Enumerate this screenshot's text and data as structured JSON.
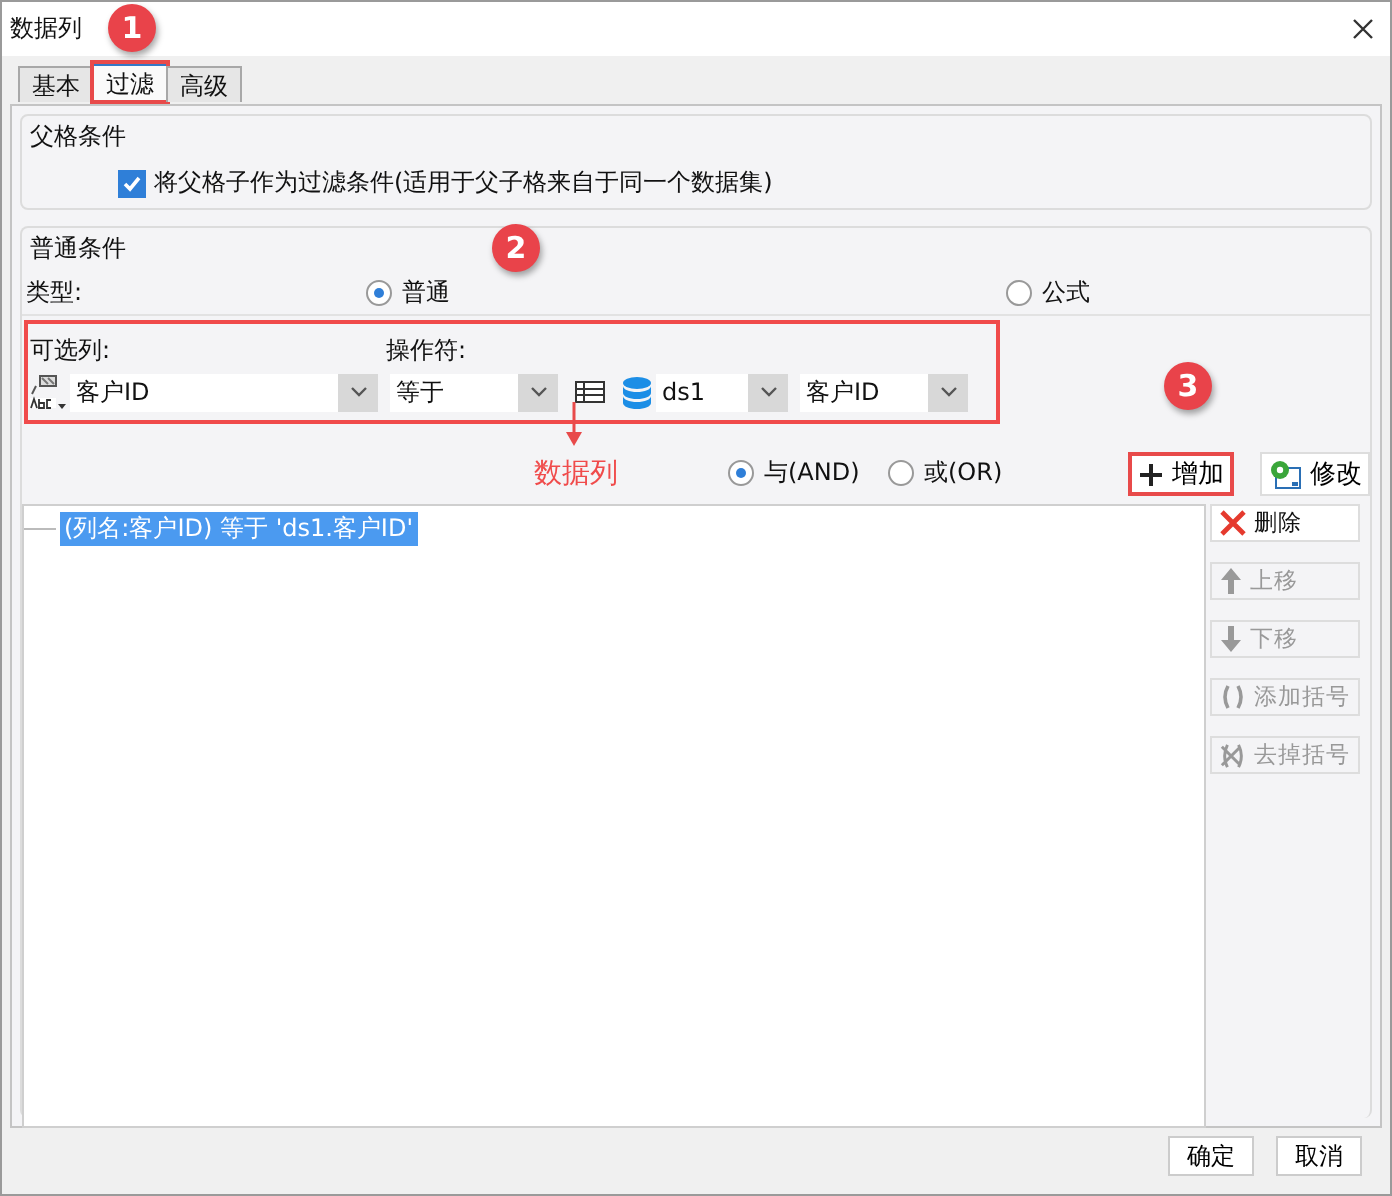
{
  "window": {
    "title": "数据列"
  },
  "tabs": [
    {
      "label": "基本",
      "selected": false,
      "highlighted": false
    },
    {
      "label": "过滤",
      "selected": true,
      "highlighted": true
    },
    {
      "label": "高级",
      "selected": false,
      "highlighted": false
    }
  ],
  "parent_condition": {
    "title": "父格条件",
    "checkbox": {
      "label": "将父格子作为过滤条件(适用于父子格来自于同一个数据集)",
      "checked": true
    }
  },
  "normal_condition": {
    "title": "普通条件",
    "type_label": "类型:",
    "type_options": [
      {
        "label": "普通",
        "selected": true
      },
      {
        "label": "公式",
        "selected": false
      }
    ],
    "selector": {
      "highlighted": true,
      "column_label": "可选列:",
      "operator_label": "操作符:",
      "column": "客户ID",
      "operator": "等于",
      "dataset": "ds1",
      "dataset_column": "客户ID"
    }
  },
  "logic_options": [
    {
      "label": "与(AND)",
      "selected": true
    },
    {
      "label": "或(OR)",
      "selected": false
    }
  ],
  "action_buttons": [
    {
      "label": "增加",
      "kind": "add",
      "highlighted": true
    },
    {
      "label": "修改",
      "kind": "edit",
      "highlighted": false
    }
  ],
  "conditions": [
    {
      "text": "(列名:客户ID) 等于 'ds1.客户ID'",
      "selected": true
    }
  ],
  "side_buttons": [
    {
      "label": "删除",
      "kind": "delete",
      "disabled": false
    },
    {
      "label": "上移",
      "kind": "up",
      "disabled": true
    },
    {
      "label": "下移",
      "kind": "down",
      "disabled": true
    },
    {
      "label": "添加括号",
      "kind": "add_brackets",
      "disabled": true
    },
    {
      "label": "去掉括号",
      "kind": "remove_brackets",
      "disabled": true
    }
  ],
  "footer_buttons": [
    "确定",
    "取消"
  ],
  "annotations": {
    "markers": [
      "1",
      "2",
      "3"
    ],
    "arrow_label": "数据列"
  }
}
